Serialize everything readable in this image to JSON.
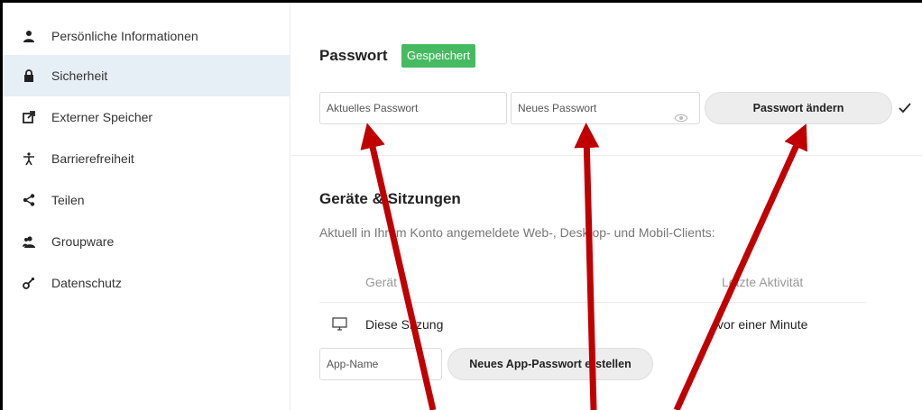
{
  "sidebar": {
    "items": [
      {
        "label": "Persönliche Informationen",
        "icon": "person-icon"
      },
      {
        "label": "Sicherheit",
        "icon": "lock-icon",
        "active": true
      },
      {
        "label": "Externer Speicher",
        "icon": "external-link-icon"
      },
      {
        "label": "Barrierefreiheit",
        "icon": "accessibility-icon"
      },
      {
        "label": "Teilen",
        "icon": "share-icon"
      },
      {
        "label": "Groupware",
        "icon": "group-icon"
      },
      {
        "label": "Datenschutz",
        "icon": "key-icon"
      }
    ]
  },
  "password": {
    "title": "Passwort",
    "saved_badge": "Gespeichert",
    "current_placeholder": "Aktuelles Passwort",
    "new_placeholder": "Neues Passwort",
    "change_button": "Passwort ändern"
  },
  "devices": {
    "title": "Geräte & Sitzungen",
    "subtitle": "Aktuell in Ihrem Konto angemeldete Web-, Desktop- und Mobil-Clients:",
    "col_device": "Gerät",
    "col_activity": "Letzte Aktivität",
    "session_name": "Diese Sitzung",
    "session_activity": "vor einer Minute",
    "app_name_placeholder": "App-Name",
    "create_app_password": "Neues App-Passwort erstellen"
  },
  "colors": {
    "badge": "#46ba61",
    "active_nav": "#e6eef6",
    "arrow": "#c00000"
  }
}
